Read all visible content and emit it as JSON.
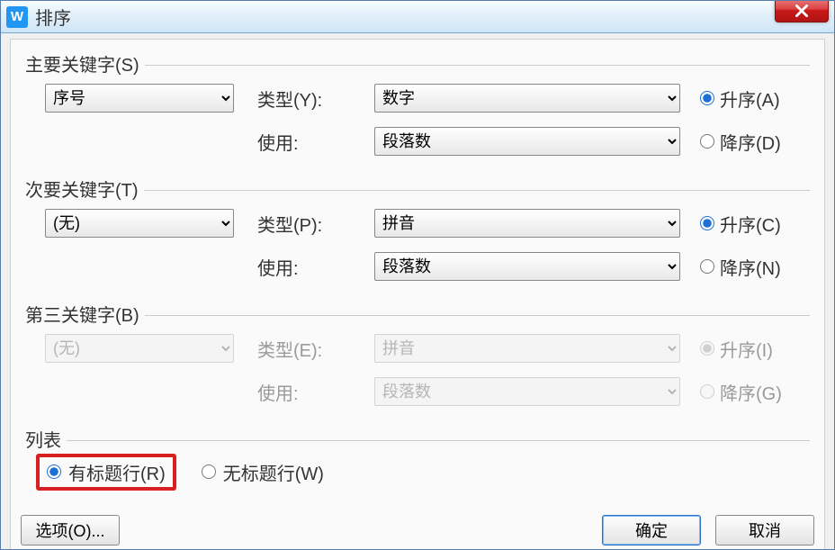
{
  "title": "排序",
  "groups": {
    "primary": {
      "legend": "主要关键字(S)",
      "key_value": "序号",
      "type_label": "类型(Y):",
      "type_value": "数字",
      "use_label": "使用:",
      "use_value": "段落数",
      "asc_label": "升序(A)",
      "desc_label": "降序(D)",
      "order": "asc",
      "enabled": true
    },
    "secondary": {
      "legend": "次要关键字(T)",
      "key_value": "(无)",
      "type_label": "类型(P):",
      "type_value": "拼音",
      "use_label": "使用:",
      "use_value": "段落数",
      "asc_label": "升序(C)",
      "desc_label": "降序(N)",
      "order": "asc",
      "enabled": true
    },
    "third": {
      "legend": "第三关键字(B)",
      "key_value": "(无)",
      "type_label": "类型(E):",
      "type_value": "拼音",
      "use_label": "使用:",
      "use_value": "段落数",
      "asc_label": "升序(I)",
      "desc_label": "降序(G)",
      "order": "asc",
      "enabled": false
    }
  },
  "list_section": {
    "legend": "列表",
    "has_header_label": "有标题行(R)",
    "no_header_label": "无标题行(W)",
    "selected": "has_header"
  },
  "footer": {
    "options": "选项(O)...",
    "ok": "确定",
    "cancel": "取消"
  }
}
